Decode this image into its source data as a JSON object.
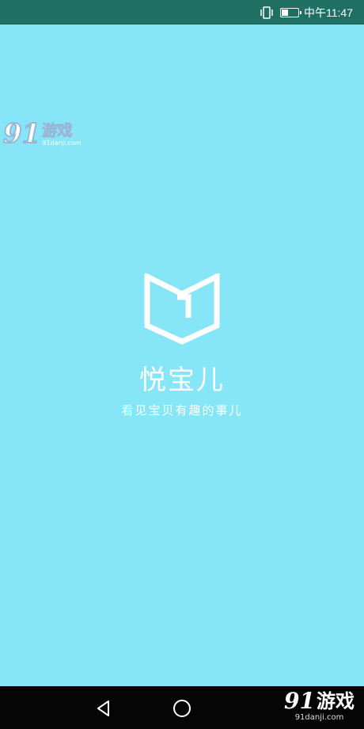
{
  "status_bar": {
    "time": "中午11:47",
    "battery_level": 0.35,
    "icons": [
      "vibrate-icon",
      "battery-icon"
    ]
  },
  "watermark_top": {
    "mark": "91",
    "name": "游戏",
    "url": "91danji.com"
  },
  "app": {
    "name": "悦宝儿",
    "slogan": "看见宝贝有趣的事儿",
    "logo_icon": "open-book-logo-icon"
  },
  "nav_bar": {
    "buttons": [
      "back-icon",
      "home-icon"
    ]
  },
  "watermark_bottom": {
    "mark": "91",
    "name": "游戏",
    "url": "91danji.com"
  },
  "colors": {
    "background": "#86E6F8",
    "status_bar": "#1F6F63",
    "nav_bar": "#050505",
    "foreground": "#FFFFFF"
  }
}
